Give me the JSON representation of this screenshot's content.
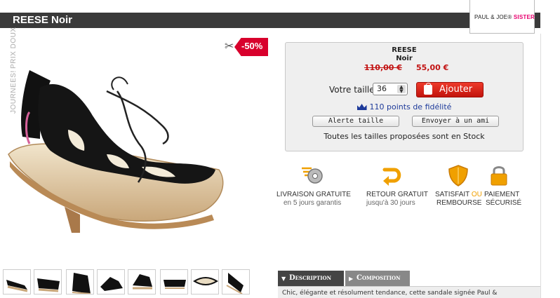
{
  "product": {
    "title": "REESE Noir",
    "brand_prefix": "PAUL & JOE",
    "brand_suffix": "SISTER",
    "name": "REESE",
    "color": "Noir",
    "discount": "-50%"
  },
  "side_tabs": [
    "PRIX DOUX",
    "JOURNEES!"
  ],
  "pricing": {
    "old_price": "110,00 €",
    "new_price": "55,00 €"
  },
  "size": {
    "label": "Votre taille",
    "selected": "36"
  },
  "actions": {
    "add_label": "Ajouter",
    "alert_label": "Alerte taille",
    "friend_label": "Envoyer à un ami"
  },
  "loyalty": {
    "points_text": "110 points de fidélité"
  },
  "stock": {
    "text": "Toutes les tailles proposées sont en Stock"
  },
  "features": [
    {
      "icon": "delivery-disc-icon",
      "line1": "LIVRAISON GRATUITE",
      "line2": "en 5 jours garantis"
    },
    {
      "icon": "return-arrow-icon",
      "line1": "RETOUR GRATUIT",
      "line2": "jusqu'à 30 jours"
    },
    {
      "icon": "shield-icon",
      "line1a": "SATISFAIT",
      "line1b": "OU",
      "line2": "REMBOURSE"
    },
    {
      "icon": "padlock-icon",
      "line1": "PAIEMENT",
      "line2": "SÉCURISÉ"
    }
  ],
  "description_tabs": {
    "description": "Description",
    "composition": "Composition",
    "text": "Chic, élégante et résolument tendance, cette sandale signée Paul &"
  },
  "colors": {
    "title_bar": "#3a3a3a",
    "price_red": "#c21313",
    "add_button": "#d8261b",
    "points_blue": "#1d3a9a",
    "brand_pink": "#e8006f",
    "icon_orange": "#f0a000"
  }
}
